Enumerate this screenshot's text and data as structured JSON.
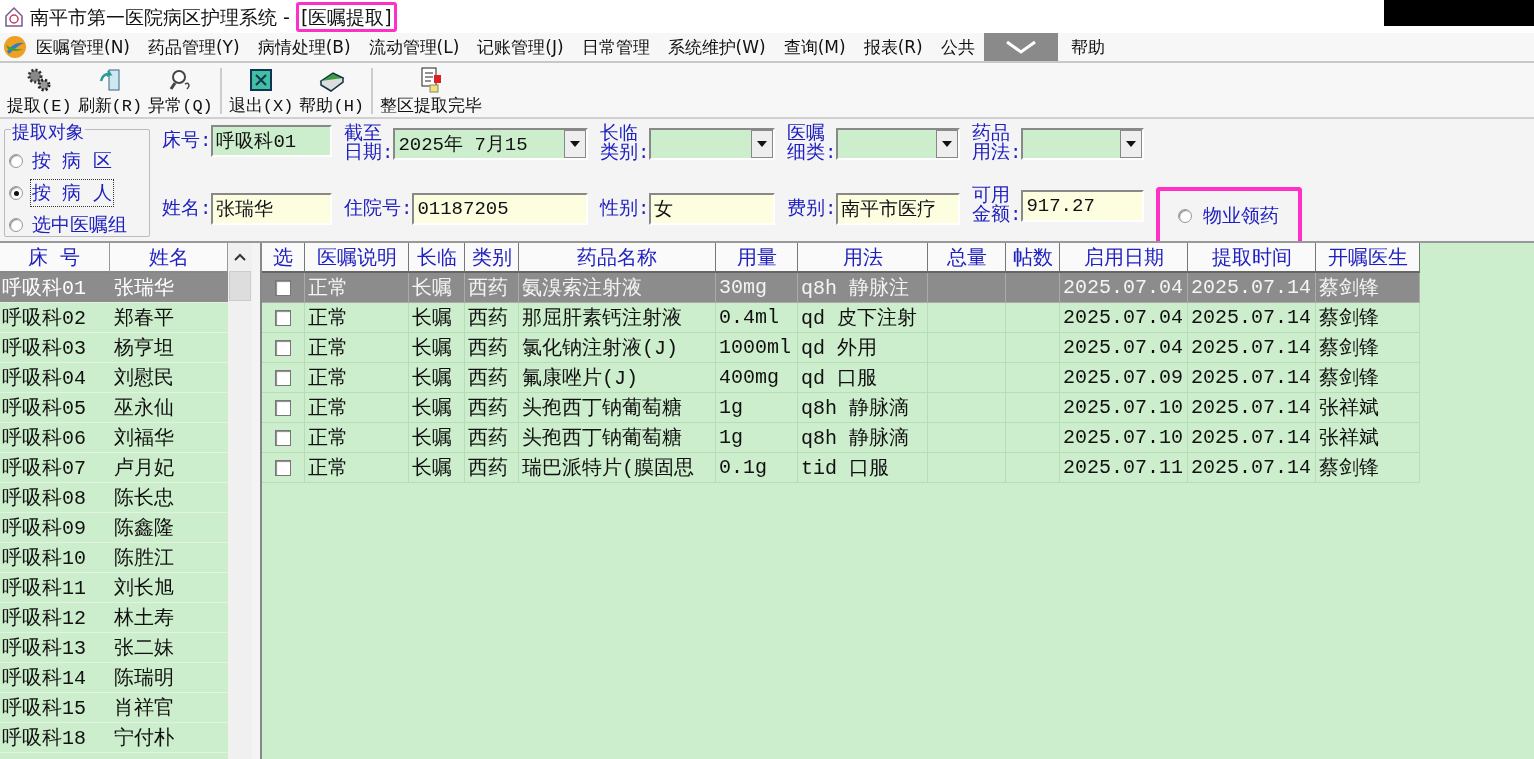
{
  "window": {
    "title": "南平市第一医院病区护理系统 - [医嘱提取]",
    "highlighted": true
  },
  "menu": {
    "items": [
      "医嘱管理(N)",
      "药品管理(Y)",
      "病情处理(B)",
      "流动管理(L)",
      "记账管理(J)",
      "日常管理",
      "系统维护(W)",
      "查询(M)",
      "报表(R)",
      "公共",
      "帮助"
    ]
  },
  "toolbar": {
    "groups": [
      [
        {
          "label": "提取(E)",
          "kind": "extract"
        },
        {
          "label": "刷新(R)",
          "kind": "refresh"
        },
        {
          "label": "异常(Q)",
          "kind": "abnormal"
        }
      ],
      [
        {
          "label": "退出(X)",
          "kind": "exit"
        },
        {
          "label": "帮助(H)",
          "kind": "help"
        }
      ],
      [
        {
          "label": "整区提取完毕",
          "kind": "finish"
        }
      ]
    ]
  },
  "form": {
    "target_group": {
      "title": "提取对象",
      "options": [
        {
          "label": "按 病 区",
          "selected": false
        },
        {
          "label": "按 病 人",
          "selected": true
        },
        {
          "label": "选中医嘱组",
          "selected": false
        }
      ]
    },
    "columns": [
      {
        "top": {
          "label": "床号:",
          "value": "呼吸科01",
          "kind": "lookup"
        },
        "bottom": {
          "label": "姓名:",
          "value": "张瑞华",
          "kind": "text"
        }
      },
      {
        "top": {
          "label": "截至日期:",
          "value": "2025年 7月15",
          "kind": "dropdown"
        },
        "bottom": {
          "label": "住院号:",
          "value": "01187205",
          "kind": "text"
        }
      },
      {
        "top": {
          "label": "长临类别:",
          "kind": "dropdown"
        },
        "bottom": {
          "label": "性别:",
          "value": "女",
          "kind": "text"
        }
      },
      {
        "top": {
          "label": "医嘱细类:",
          "kind": "dropdown"
        },
        "bottom": {
          "label": "费别:",
          "value": "南平市医疗",
          "kind": "text"
        }
      },
      {
        "top": {
          "label": "药品用法:",
          "kind": "dropdown"
        },
        "bottom": {
          "label": "可用金额:",
          "value": "917.27",
          "kind": "text"
        }
      }
    ],
    "pickup": {
      "label": "物业领药",
      "selected": false,
      "highlighted": true
    }
  },
  "patients": {
    "columns": [
      "床 号",
      "姓名"
    ],
    "rows": [
      {
        "bed": "呼吸科01",
        "name": "张瑞华",
        "selected": true
      },
      {
        "bed": "呼吸科02",
        "name": "郑春平",
        "selected": false
      },
      {
        "bed": "呼吸科03",
        "name": "杨亨坦",
        "selected": false
      },
      {
        "bed": "呼吸科04",
        "name": "刘慰民",
        "selected": false
      },
      {
        "bed": "呼吸科05",
        "name": "巫永仙",
        "selected": false
      },
      {
        "bed": "呼吸科06",
        "name": "刘福华",
        "selected": false
      },
      {
        "bed": "呼吸科07",
        "name": "卢月妃",
        "selected": false
      },
      {
        "bed": "呼吸科08",
        "name": "陈长忠",
        "selected": false
      },
      {
        "bed": "呼吸科09",
        "name": "陈鑫隆",
        "selected": false
      },
      {
        "bed": "呼吸科10",
        "name": "陈胜江",
        "selected": false
      },
      {
        "bed": "呼吸科11",
        "name": "刘长旭",
        "selected": false
      },
      {
        "bed": "呼吸科12",
        "name": "林土寿",
        "selected": false
      },
      {
        "bed": "呼吸科13",
        "name": "张二妹",
        "selected": false
      },
      {
        "bed": "呼吸科14",
        "name": "陈瑞明",
        "selected": false
      },
      {
        "bed": "呼吸科15",
        "name": "肖祥官",
        "selected": false
      },
      {
        "bed": "呼吸科18",
        "name": "宁付朴",
        "selected": false
      }
    ]
  },
  "orders": {
    "columns": [
      "选",
      "医嘱说明",
      "长临",
      "类别",
      "药品名称",
      "用量",
      "用法",
      "总量",
      "帖数",
      "启用日期",
      "提取时间",
      "开嘱医生"
    ],
    "rows": [
      {
        "selected": true,
        "checked": false,
        "note": "正常",
        "term": "长嘱",
        "category": "西药",
        "drug": "氨溴索注射液",
        "dose": "30mg",
        "usage": "q8h 静脉注",
        "start_date": "2025.07.04",
        "extract_time": "2025.07.14",
        "doctor": "蔡剑锋"
      },
      {
        "selected": false,
        "checked": false,
        "note": "正常",
        "term": "长嘱",
        "category": "西药",
        "drug": "那屈肝素钙注射液",
        "dose": "0.4ml",
        "usage": "qd 皮下注射",
        "start_date": "2025.07.04",
        "extract_time": "2025.07.14",
        "doctor": "蔡剑锋"
      },
      {
        "selected": false,
        "checked": false,
        "note": "正常",
        "term": "长嘱",
        "category": "西药",
        "drug": "氯化钠注射液(J)",
        "dose": "1000ml",
        "usage": "qd 外用",
        "start_date": "2025.07.04",
        "extract_time": "2025.07.14",
        "doctor": "蔡剑锋"
      },
      {
        "selected": false,
        "checked": false,
        "note": "正常",
        "term": "长嘱",
        "category": "西药",
        "drug": "氟康唑片(J)",
        "dose": "400mg",
        "usage": "qd 口服",
        "start_date": "2025.07.09",
        "extract_time": "2025.07.14",
        "doctor": "蔡剑锋"
      },
      {
        "selected": false,
        "checked": false,
        "note": "正常",
        "term": "长嘱",
        "category": "西药",
        "drug": "头孢西丁钠葡萄糖",
        "dose": "1g",
        "usage": "q8h 静脉滴",
        "start_date": "2025.07.10",
        "extract_time": "2025.07.14",
        "doctor": "张祥斌"
      },
      {
        "selected": false,
        "checked": false,
        "note": "正常",
        "term": "长嘱",
        "category": "西药",
        "drug": "头孢西丁钠葡萄糖",
        "dose": "1g",
        "usage": "q8h 静脉滴",
        "start_date": "2025.07.10",
        "extract_time": "2025.07.14",
        "doctor": "张祥斌"
      },
      {
        "selected": false,
        "checked": false,
        "note": "正常",
        "term": "长嘱",
        "category": "西药",
        "drug": "瑞巴派特片(膜固思",
        "dose": "0.1g",
        "usage": "tid 口服",
        "start_date": "2025.07.11",
        "extract_time": "2025.07.14",
        "doctor": "蔡剑锋"
      }
    ]
  }
}
